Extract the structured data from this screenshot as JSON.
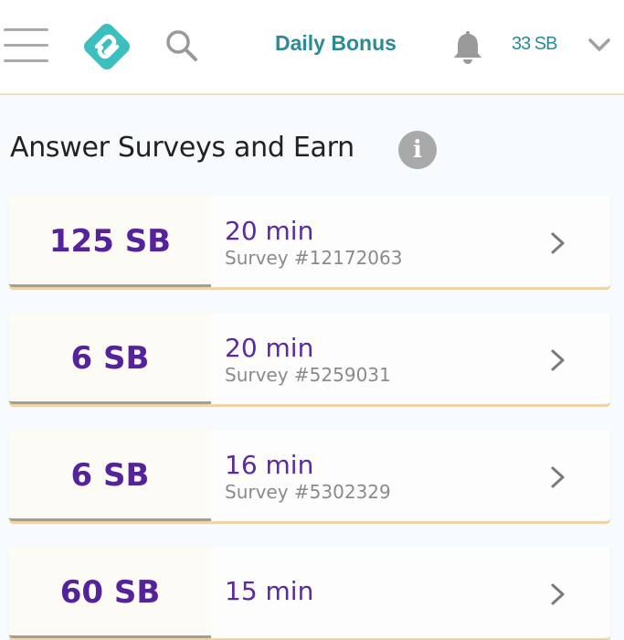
{
  "header": {
    "menu_icon": "hamburger-menu-icon",
    "logo_icon": "swagbucks-logo-icon",
    "search_icon": "search-icon",
    "daily_bonus_label": "Daily Bonus",
    "bell_icon": "bell-icon",
    "balance": "33 SB",
    "dropdown_icon": "chevron-down-icon"
  },
  "main": {
    "title": "Answer Surveys and Earn",
    "info_icon": "info-icon",
    "info_glyph": "i",
    "surveys": [
      {
        "reward": "125 SB",
        "duration": "20 min",
        "survey_id": "Survey #12172063"
      },
      {
        "reward": "6 SB",
        "duration": "20 min",
        "survey_id": "Survey #5259031"
      },
      {
        "reward": "6 SB",
        "duration": "16 min",
        "survey_id": "Survey #5302329"
      },
      {
        "reward": "60 SB",
        "duration": "15 min",
        "survey_id": ""
      }
    ]
  },
  "colors": {
    "accent_teal": "#2a8a96",
    "reward_purple": "#54229a",
    "card_underline": "#f0d3a8"
  }
}
